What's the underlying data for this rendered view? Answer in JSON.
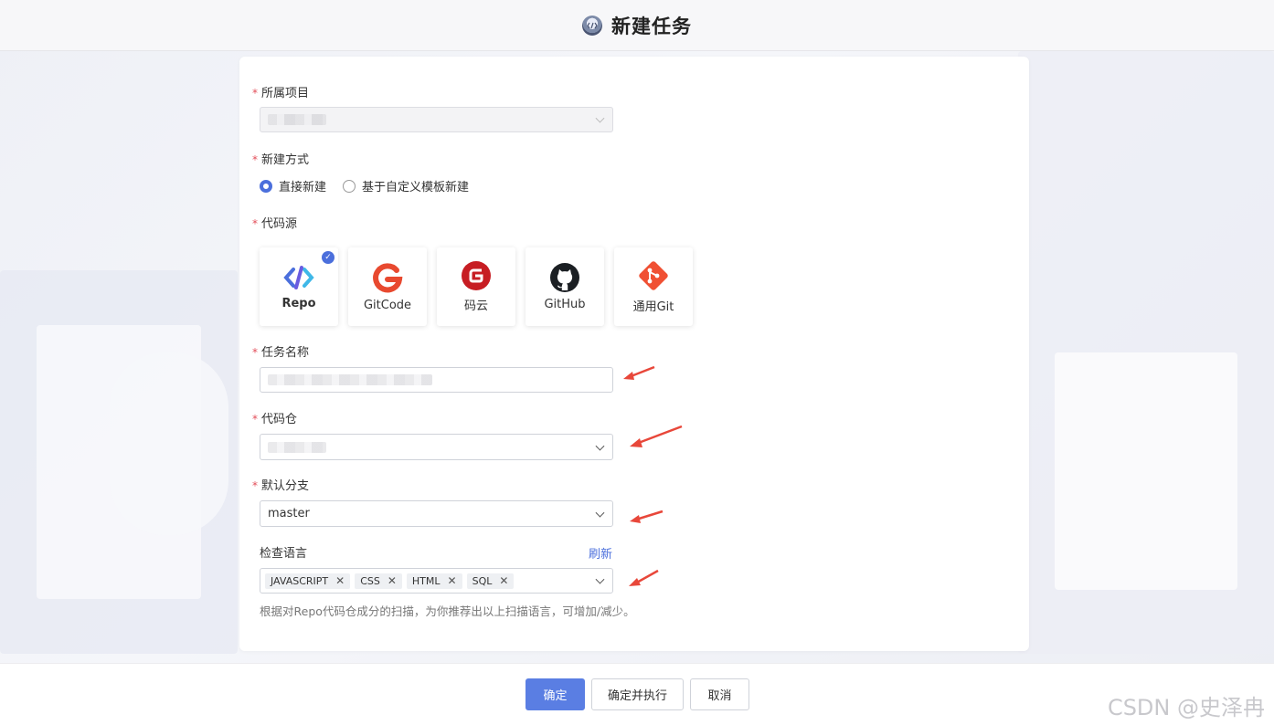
{
  "header": {
    "title": "新建任务",
    "icon": "task-logo-icon"
  },
  "form": {
    "project": {
      "label": "所属项目",
      "required": "*"
    },
    "create_mode": {
      "label": "新建方式",
      "required": "*",
      "options": [
        {
          "label": "直接新建",
          "selected": true
        },
        {
          "label": "基于自定义模板新建",
          "selected": false
        }
      ]
    },
    "code_source": {
      "label": "代码源",
      "required": "*",
      "items": [
        {
          "label": "Repo",
          "selected": true,
          "icon": "repo-icon",
          "color": "#4b6fdc"
        },
        {
          "label": "GitCode",
          "selected": false,
          "icon": "gitcode-icon",
          "color": "#e8492f"
        },
        {
          "label": "码云",
          "selected": false,
          "icon": "gitee-icon",
          "color": "#c71d23"
        },
        {
          "label": "GitHub",
          "selected": false,
          "icon": "github-icon",
          "color": "#1b1f23"
        },
        {
          "label": "通用Git",
          "selected": false,
          "icon": "git-icon",
          "color": "#f05033"
        }
      ],
      "check_mark": "✓"
    },
    "task_name": {
      "label": "任务名称",
      "required": "*"
    },
    "code_repo": {
      "label": "代码仓",
      "required": "*"
    },
    "default_branch": {
      "label": "默认分支",
      "required": "*",
      "value": "master"
    },
    "check_language": {
      "label": "检查语言",
      "refresh_label": "刷新",
      "tags": [
        "JAVASCRIPT",
        "CSS",
        "HTML",
        "SQL"
      ],
      "remove_glyph": "✕",
      "hint": "根据对Repo代码仓成分的扫描，为你推荐出以上扫描语言，可增加/减少。"
    }
  },
  "footer": {
    "confirm": "确定",
    "confirm_run": "确定并执行",
    "cancel": "取消",
    "watermark": "CSDN @史泽冉"
  },
  "colors": {
    "accent": "#4b6fdc",
    "primary_button": "#5a7ee3",
    "required": "#e34d59",
    "arrow": "#e8473a"
  }
}
